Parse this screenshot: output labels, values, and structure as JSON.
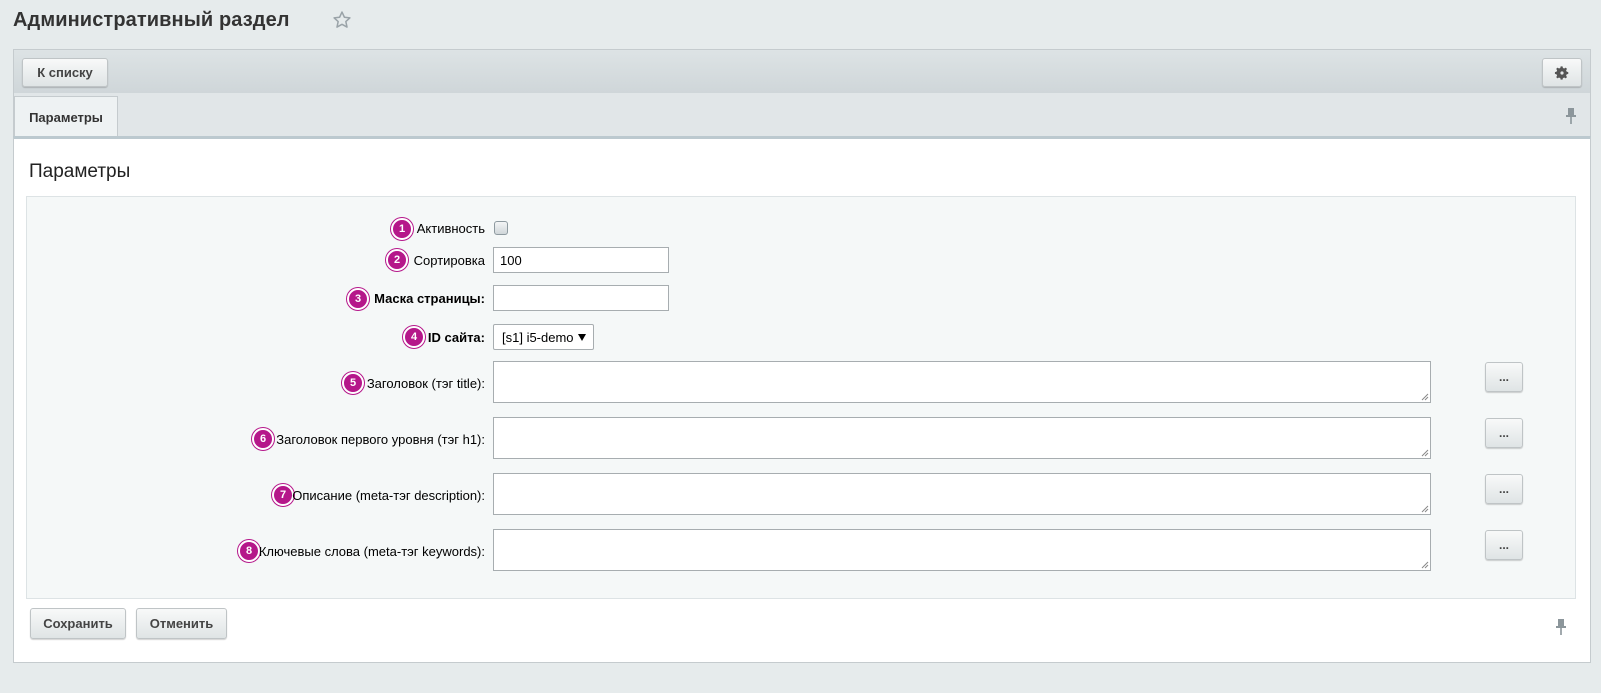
{
  "header": {
    "title": "Административный раздел",
    "star_icon": "star-outline-icon"
  },
  "toolbar": {
    "back_label": "К списку",
    "settings_icon": "gear-icon"
  },
  "tabs": [
    {
      "label": "Параметры",
      "active": true
    }
  ],
  "panel": {
    "title": "Параметры",
    "fields": [
      {
        "badge": "1",
        "label": "Активность",
        "type": "checkbox",
        "checked": false
      },
      {
        "badge": "2",
        "label": "Сортировка",
        "type": "text",
        "value": "100"
      },
      {
        "badge": "3",
        "label": "Маска страницы:",
        "type": "text",
        "value": "",
        "bold": true
      },
      {
        "badge": "4",
        "label": "ID сайта:",
        "type": "select",
        "value": "[s1] i5-demo",
        "bold": true
      },
      {
        "badge": "5",
        "label": "Заголовок (тэг title):",
        "type": "textarea",
        "value": "",
        "more_label": "..."
      },
      {
        "badge": "6",
        "label": "Заголовок первого уровня (тэг h1):",
        "type": "textarea",
        "value": "",
        "more_label": "..."
      },
      {
        "badge": "7",
        "label": "Описание (meta-тэг description):",
        "type": "textarea",
        "value": "",
        "more_label": "..."
      },
      {
        "badge": "8",
        "label": "Ключевые слова (meta-тэг keywords):",
        "type": "textarea",
        "value": "",
        "more_label": "..."
      }
    ]
  },
  "footer": {
    "save_label": "Сохранить",
    "cancel_label": "Отменить"
  },
  "colors": {
    "badge": "#b5178a",
    "background": "#e6ebec"
  }
}
